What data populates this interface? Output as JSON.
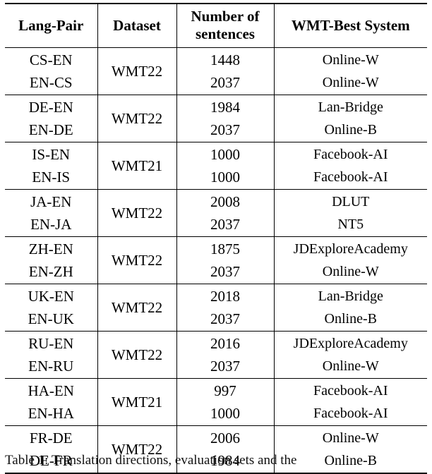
{
  "table": {
    "columns": [
      {
        "key": "lang_pair",
        "label": "Lang-Pair"
      },
      {
        "key": "dataset",
        "label": "Dataset"
      },
      {
        "key": "num_sentences",
        "label_line1": "Number of",
        "label_line2": "sentences"
      },
      {
        "key": "wmt_best_system",
        "label": "WMT-Best System"
      }
    ],
    "rows": [
      {
        "dataset": "WMT22",
        "pairs": [
          {
            "lang_pair": "CS-EN",
            "num_sentences": "1448",
            "wmt_best_system": "Online-W"
          },
          {
            "lang_pair": "EN-CS",
            "num_sentences": "2037",
            "wmt_best_system": "Online-W"
          }
        ]
      },
      {
        "dataset": "WMT22",
        "pairs": [
          {
            "lang_pair": "DE-EN",
            "num_sentences": "1984",
            "wmt_best_system": "Lan-Bridge"
          },
          {
            "lang_pair": "EN-DE",
            "num_sentences": "2037",
            "wmt_best_system": "Online-B"
          }
        ]
      },
      {
        "dataset": "WMT21",
        "pairs": [
          {
            "lang_pair": "IS-EN",
            "num_sentences": "1000",
            "wmt_best_system": "Facebook-AI"
          },
          {
            "lang_pair": "EN-IS",
            "num_sentences": "1000",
            "wmt_best_system": "Facebook-AI"
          }
        ]
      },
      {
        "dataset": "WMT22",
        "pairs": [
          {
            "lang_pair": "JA-EN",
            "num_sentences": "2008",
            "wmt_best_system": "DLUT"
          },
          {
            "lang_pair": "EN-JA",
            "num_sentences": "2037",
            "wmt_best_system": "NT5"
          }
        ]
      },
      {
        "dataset": "WMT22",
        "pairs": [
          {
            "lang_pair": "ZH-EN",
            "num_sentences": "1875",
            "wmt_best_system": "JDExploreAcademy"
          },
          {
            "lang_pair": "EN-ZH",
            "num_sentences": "2037",
            "wmt_best_system": "Online-W"
          }
        ]
      },
      {
        "dataset": "WMT22",
        "pairs": [
          {
            "lang_pair": "UK-EN",
            "num_sentences": "2018",
            "wmt_best_system": "Lan-Bridge"
          },
          {
            "lang_pair": "EN-UK",
            "num_sentences": "2037",
            "wmt_best_system": "Online-B"
          }
        ]
      },
      {
        "dataset": "WMT22",
        "pairs": [
          {
            "lang_pair": "RU-EN",
            "num_sentences": "2016",
            "wmt_best_system": "JDExploreAcademy"
          },
          {
            "lang_pair": "EN-RU",
            "num_sentences": "2037",
            "wmt_best_system": "Online-W"
          }
        ]
      },
      {
        "dataset": "WMT21",
        "pairs": [
          {
            "lang_pair": "HA-EN",
            "num_sentences": "997",
            "wmt_best_system": "Facebook-AI"
          },
          {
            "lang_pair": "EN-HA",
            "num_sentences": "1000",
            "wmt_best_system": "Facebook-AI"
          }
        ]
      },
      {
        "dataset": "WMT22",
        "pairs": [
          {
            "lang_pair": "FR-DE",
            "num_sentences": "2006",
            "wmt_best_system": "Online-W"
          },
          {
            "lang_pair": "DE-FR",
            "num_sentences": "1984",
            "wmt_best_system": "Online-B"
          }
        ]
      }
    ]
  },
  "caption": {
    "text": "Table 1: Translation directions, evaluation sets and the"
  }
}
